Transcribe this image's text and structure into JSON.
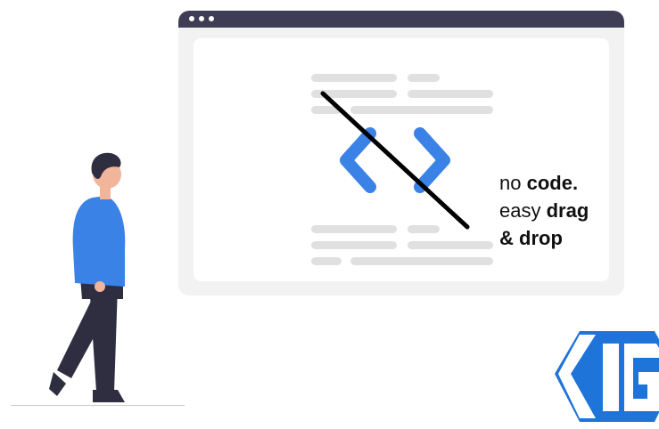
{
  "browser": {
    "window_dots": 3
  },
  "tagline": {
    "line1_plain": "no ",
    "line1_bold": "code.",
    "line2_plain": "easy ",
    "line2_bold": "drag",
    "line3_bold": "& drop"
  },
  "icons": {
    "code": "code-brackets-icon",
    "strike": "strike-through-line",
    "logo": "hexagon-g-logo",
    "person": "walking-person-illustration"
  },
  "colors": {
    "browser_bar": "#3f3d56",
    "browser_bg": "#f2f2f2",
    "panel_bg": "#ffffff",
    "placeholder": "#e0e0e0",
    "accent_blue": "#3b82e6",
    "shirt_blue": "#3b82e6",
    "skin": "#f1b59b",
    "dark": "#2f2e41",
    "logo_blue": "#1f74d9"
  }
}
